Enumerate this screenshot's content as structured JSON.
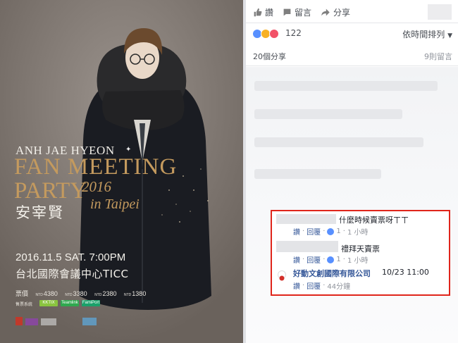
{
  "poster": {
    "artist_name": "ANH JAE HYEON",
    "event_line1": "FAN MEETING",
    "event_line2": "PARTY",
    "year": "2016",
    "location_script": "in Taipei",
    "korean_name": "安宰賢",
    "date": "2016.11.5 SAT. 7:00PM",
    "venue": "台北國際會議中心TICC",
    "price_label": "票價",
    "price_currency": "NTD",
    "prices": [
      "4380",
      "3380",
      "2380",
      "1380"
    ],
    "ticket_label": "售票系統",
    "ticket_logos": [
      "KKTIX",
      "Teamlink",
      "FamiPort"
    ],
    "colors": {
      "gold": "#c49a5e",
      "bg": "#7a726c"
    }
  },
  "post": {
    "actions": {
      "like": "讚",
      "comment": "留言",
      "share": "分享"
    },
    "reactions": {
      "count": "122",
      "types": [
        "like-icon",
        "wow-icon",
        "love-icon"
      ]
    },
    "sort_label": "依時間排列",
    "shares": "20個分享",
    "comments_count": "9則留言"
  },
  "comments": [
    {
      "text": "什麼時候賣票呀ㄒㄒ",
      "like": "讚",
      "reply": "回覆",
      "likes": "1",
      "time": "1 小時"
    },
    {
      "text": "禮拜天賣票",
      "like": "讚",
      "reply": "回覆",
      "likes": "1",
      "time": "1 小時"
    },
    {
      "author": "好動文創國際有限公司",
      "text": "10/23 11:00",
      "like": "讚",
      "reply": "回覆",
      "time": "44分鐘"
    }
  ]
}
